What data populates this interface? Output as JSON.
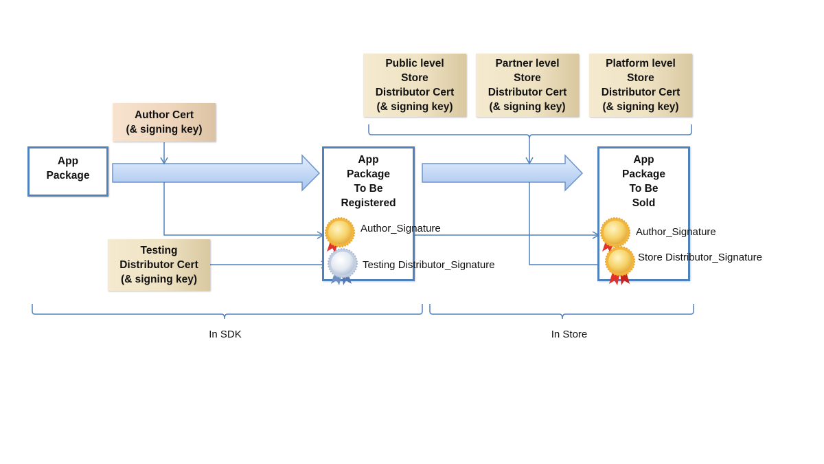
{
  "colors": {
    "connector": "#4f81bd",
    "arrow_fill_top": "#dce9fb",
    "arrow_fill_bottom": "#a9c6f0",
    "cert_fill": "#efe3c4",
    "medal_gold": "#f6cf5a",
    "medal_silver": "#dfe6f0",
    "ribbon_red": "#e0322a",
    "ribbon_blue": "#6e8fc2"
  },
  "certs": {
    "author": {
      "label": "Author Cert\n(& signing key)"
    },
    "testing": {
      "label": "Testing\nDistributor Cert\n(& signing key)"
    },
    "public": {
      "label": "Public level\nStore\nDistributor Cert\n(& signing key)"
    },
    "partner": {
      "label": "Partner level\nStore\nDistributor Cert\n(& signing key)"
    },
    "platform": {
      "label": "Platform level\nStore\nDistributor Cert\n(& signing key)"
    }
  },
  "packages": {
    "source": {
      "label": "App\nPackage"
    },
    "registered": {
      "label": "App\nPackage\nTo Be\nRegistered",
      "signatures": [
        {
          "label": "Author_Signature",
          "medal": "gold"
        },
        {
          "label": "Testing Distributor_Signature",
          "medal": "silver"
        }
      ]
    },
    "sold": {
      "label": "App\nPackage\nTo Be\nSold",
      "signatures": [
        {
          "label": "Author_Signature",
          "medal": "gold"
        },
        {
          "label": "Store Distributor_Signature",
          "medal": "gold"
        }
      ]
    }
  },
  "regions": [
    {
      "label": "In SDK"
    },
    {
      "label": "In Store"
    }
  ]
}
